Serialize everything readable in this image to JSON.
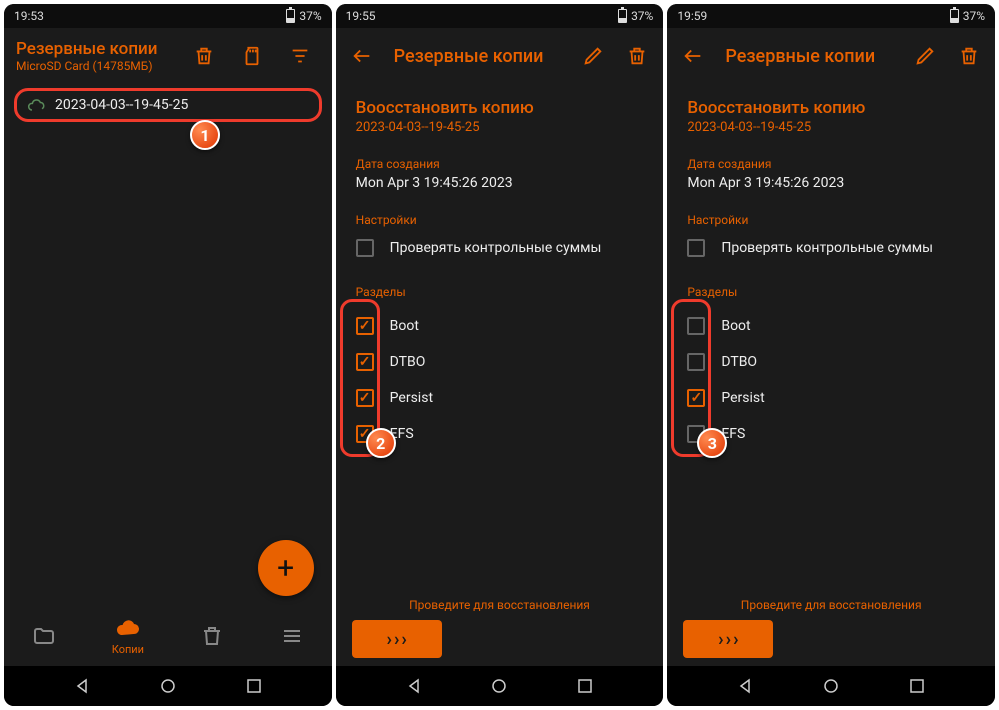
{
  "status": {
    "time1": "19:53",
    "time2": "19:55",
    "time3": "19:59",
    "battery_pct": "37%"
  },
  "s1": {
    "title": "Резервные копии",
    "subtitle": "MicroSD Card (14785МБ)",
    "backup_name": "2023-04-03--19-45-25",
    "nav_copies": "Копии"
  },
  "detail": {
    "header_title": "Резервные копии",
    "restore_title": "Воосстановить копию",
    "backup_id": "2023-04-03--19-45-25",
    "date_label": "Дата создания",
    "date_value": "Mon Apr  3 19:45:26 2023",
    "settings_label": "Настройки",
    "checksum_label": "Проверять контрольные суммы",
    "partitions_label": "Разделы",
    "partitions": {
      "boot": "Boot",
      "dtbo": "DTBO",
      "persist": "Persist",
      "efs": "EFS"
    },
    "swipe_label": "Проведите для восстановления"
  },
  "callouts": {
    "b1": "1",
    "b2": "2",
    "b3": "3"
  }
}
